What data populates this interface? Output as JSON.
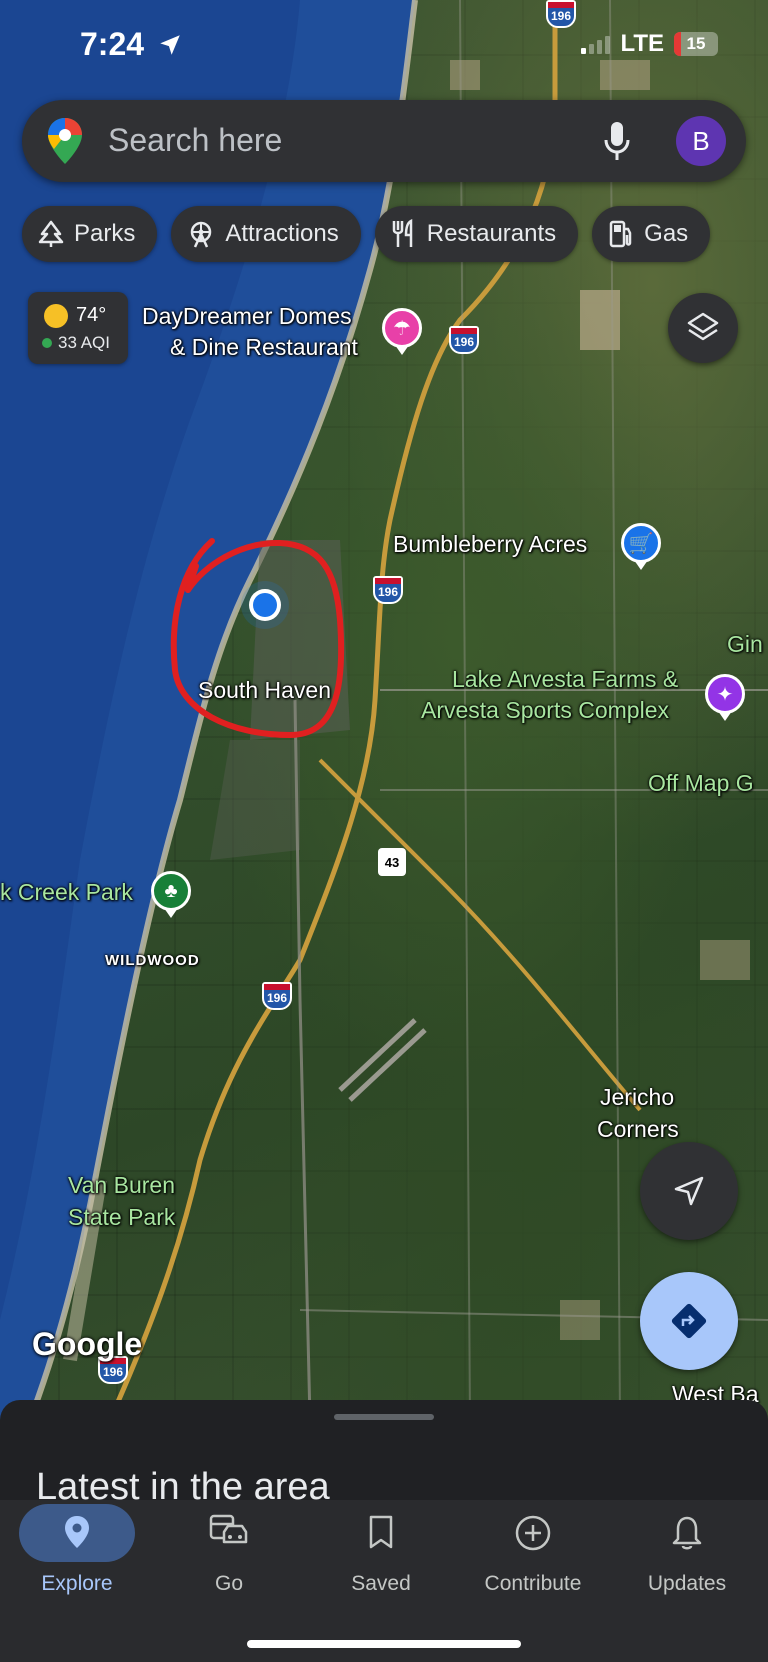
{
  "status_bar": {
    "time": "7:24",
    "network": "LTE",
    "battery": "15"
  },
  "search": {
    "placeholder": "Search here",
    "avatar_letter": "B"
  },
  "chips": [
    {
      "label": "Parks",
      "icon": "tree-icon"
    },
    {
      "label": "Attractions",
      "icon": "ferris-wheel-icon"
    },
    {
      "label": "Restaurants",
      "icon": "fork-knife-icon"
    },
    {
      "label": "Gas",
      "icon": "gas-pump-icon"
    }
  ],
  "weather": {
    "temp": "74°",
    "aqi": "33 AQI"
  },
  "map": {
    "places": {
      "daydreamer_line1": "DayDreamer Domes",
      "daydreamer_line2": "& Dine Restaurant",
      "bumbleberry": "Bumbleberry Acres",
      "arvesta_line1": "Lake Arvesta Farms &",
      "arvesta_line2": "Arvesta Sports Complex",
      "off_map": "Off Map G",
      "gin": "Gin",
      "south_haven": "South Haven",
      "creek_park": "k Creek Park",
      "wildwood": "WILDWOOD",
      "jericho_line1": "Jericho",
      "jericho_line2": "Corners",
      "van_buren_line1": "Van Buren",
      "van_buren_line2": "State Park",
      "west_ba": "West Ba"
    },
    "shields": {
      "i196": "196",
      "m43": "43"
    },
    "attribution": "Google",
    "colors": {
      "water": "#1f4e9a",
      "location_dot": "#1a73e8",
      "annotation": "#e02020"
    }
  },
  "sheet": {
    "title": "Latest in the area"
  },
  "nav": [
    {
      "label": "Explore",
      "icon": "location-pin-icon",
      "active": true
    },
    {
      "label": "Go",
      "icon": "car-icon",
      "active": false
    },
    {
      "label": "Saved",
      "icon": "bookmark-icon",
      "active": false
    },
    {
      "label": "Contribute",
      "icon": "plus-circle-icon",
      "active": false
    },
    {
      "label": "Updates",
      "icon": "bell-icon",
      "active": false
    }
  ]
}
